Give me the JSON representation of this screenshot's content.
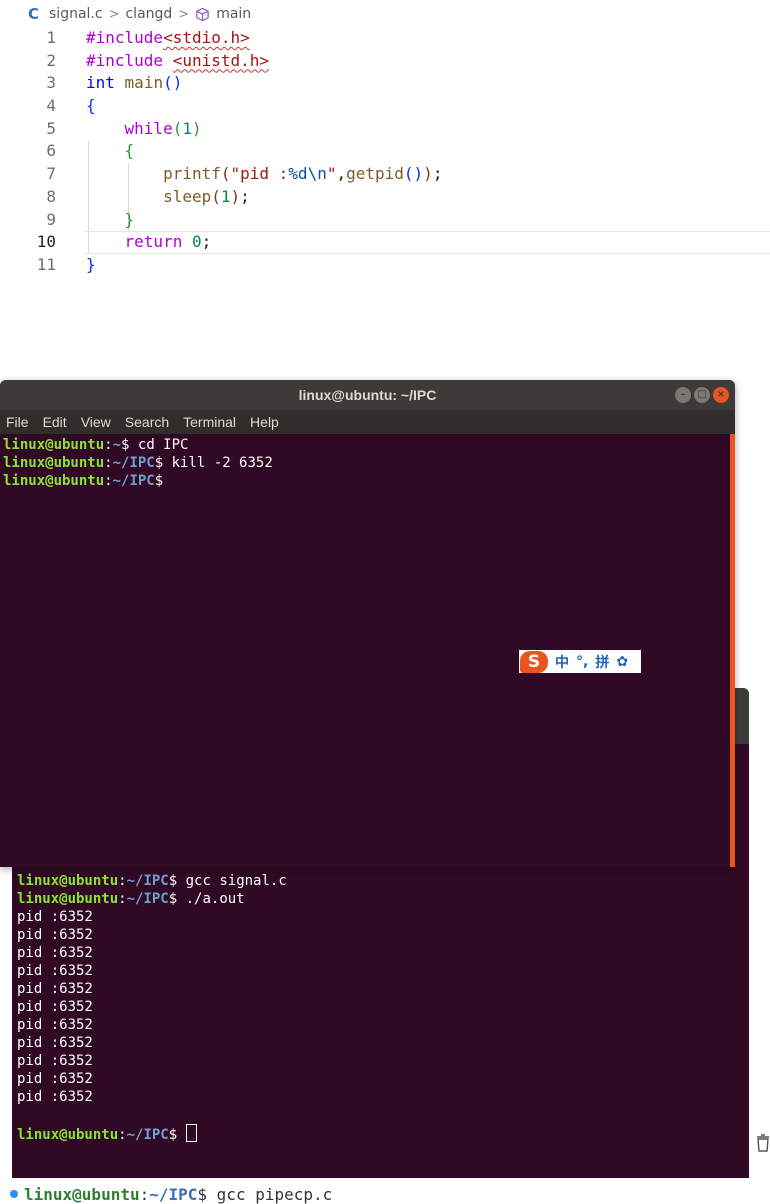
{
  "editor": {
    "breadcrumb": {
      "lang_icon": "C",
      "file": "signal.c",
      "folder": "clangd",
      "symbol": "main"
    },
    "active_line": 10
  },
  "code_lines": [
    {
      "n": "1",
      "t": "#include<stdio.h>"
    },
    {
      "n": "2",
      "t": "#include <unistd.h>"
    },
    {
      "n": "3",
      "t": "int main()"
    },
    {
      "n": "4",
      "t": "{"
    },
    {
      "n": "5",
      "t": "    while(1)"
    },
    {
      "n": "6",
      "t": "    {"
    },
    {
      "n": "7",
      "t": "        printf(\"pid :%d\\n\",getpid());"
    },
    {
      "n": "8",
      "t": "        sleep(1);"
    },
    {
      "n": "9",
      "t": "    }"
    },
    {
      "n": "10",
      "t": "    return 0;"
    },
    {
      "n": "11",
      "t": "}"
    }
  ],
  "front_terminal": {
    "title": "linux@ubuntu: ~/IPC",
    "menu": [
      "File",
      "Edit",
      "View",
      "Search",
      "Terminal",
      "Help"
    ],
    "lines": [
      {
        "user": "linux@ubuntu",
        "path": "~",
        "cmd": " cd IPC"
      },
      {
        "user": "linux@ubuntu",
        "path": "~/IPC",
        "cmd": " kill -2 6352"
      },
      {
        "user": "linux@ubuntu",
        "path": "~/IPC",
        "cmd": ""
      }
    ]
  },
  "back_terminal": {
    "lines": [
      {
        "user": "linux@ubuntu",
        "path": "~/IPC",
        "cmd": " gcc signal.c"
      },
      {
        "user": "linux@ubuntu",
        "path": "~/IPC",
        "cmd": " ./a.out"
      }
    ],
    "output": [
      "pid :6352",
      "pid :6352",
      "pid :6352",
      "pid :6352",
      "pid :6352",
      "pid :6352",
      "pid :6352",
      "pid :6352",
      "pid :6352",
      "pid :6352",
      "pid :6352"
    ],
    "final_prompt": {
      "user": "linux@ubuntu",
      "path": "~/IPC"
    }
  },
  "ime": {
    "logo": "S",
    "mode": "中",
    "punct": "°,",
    "input": "拼",
    "settings_icon": "gear-icon"
  },
  "bottom": {
    "user": "linux@ubuntu",
    "path": "~/IPC",
    "cmd": "$ gcc pipecp.c"
  },
  "colors": {
    "terminal_bg": "#300a24",
    "prompt_user": "#8ae234",
    "prompt_path": "#729fcf",
    "accent": "#e9541f"
  }
}
